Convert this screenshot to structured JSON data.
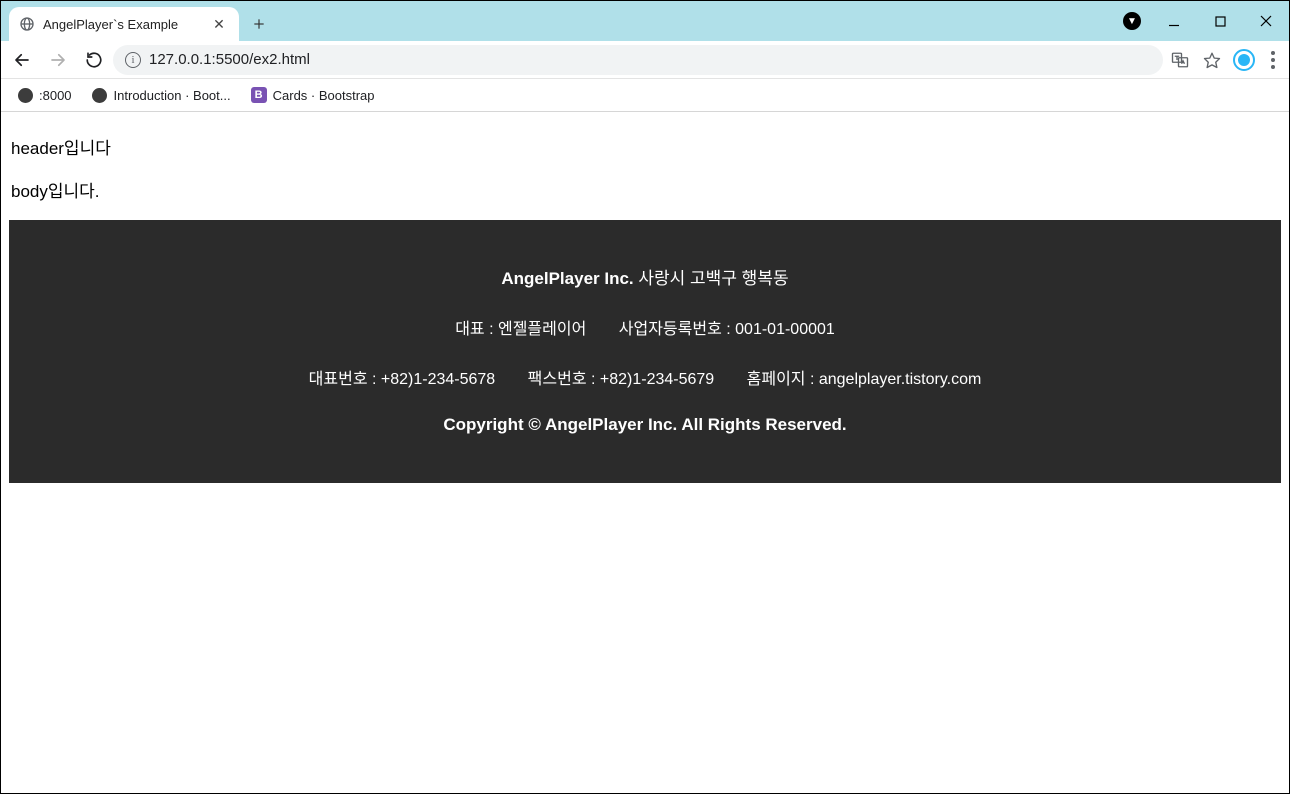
{
  "browser": {
    "tab": {
      "title": "AngelPlayer`s Example"
    },
    "url": "127.0.0.1:5500/ex2.html",
    "bookmarks": [
      {
        "icon": "globe",
        "label": ":8000"
      },
      {
        "icon": "globe",
        "label": "Introduction · Boot..."
      },
      {
        "icon": "b",
        "label": "Cards · Bootstrap"
      }
    ]
  },
  "page": {
    "header_text": "header입니다",
    "body_text": "body입니다."
  },
  "footer": {
    "company": "AngelPlayer Inc.",
    "address": "사랑시 고백구 행복동",
    "ceo": "대표 : 엔젤플레이어",
    "biz_no": "사업자등록번호 : 001-01-00001",
    "phone": "대표번호 : +82)1-234-5678",
    "fax": "팩스번호 : +82)1-234-5679",
    "homepage": "홈페이지 : angelplayer.tistory.com",
    "copyright": "Copyright © AngelPlayer Inc. All Rights Reserved."
  }
}
